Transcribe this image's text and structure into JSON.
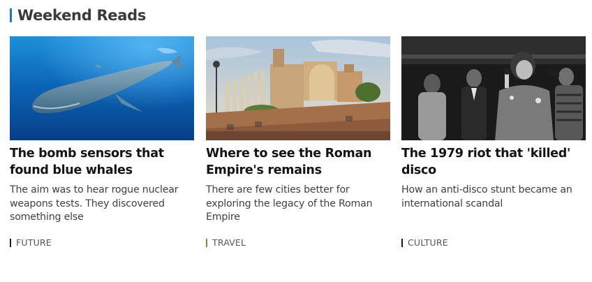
{
  "section": {
    "title": "Weekend Reads",
    "accent_color": "#1a7abf"
  },
  "cards": [
    {
      "title": "The bomb sensors that found blue whales",
      "summary": "The aim was to hear rogue nuclear weapons tests. They discovered something else",
      "tag": "FUTURE",
      "tag_color": "#1a1a1a",
      "image": "blue-whale-underwater"
    },
    {
      "title": "Where to see the Roman Empire's remains",
      "summary": "There are few cities better for exploring the legacy of the Roman Empire",
      "tag": "TRAVEL",
      "tag_color": "#5a9a3a",
      "image": "roman-ruins-temple-of-venus"
    },
    {
      "title": "The 1979 riot that 'killed' disco",
      "summary": "How an anti-disco stunt became an international scandal",
      "tag": "CULTURE",
      "tag_color": "#1a1a1a",
      "image": "black-and-white-press-crowd"
    }
  ]
}
